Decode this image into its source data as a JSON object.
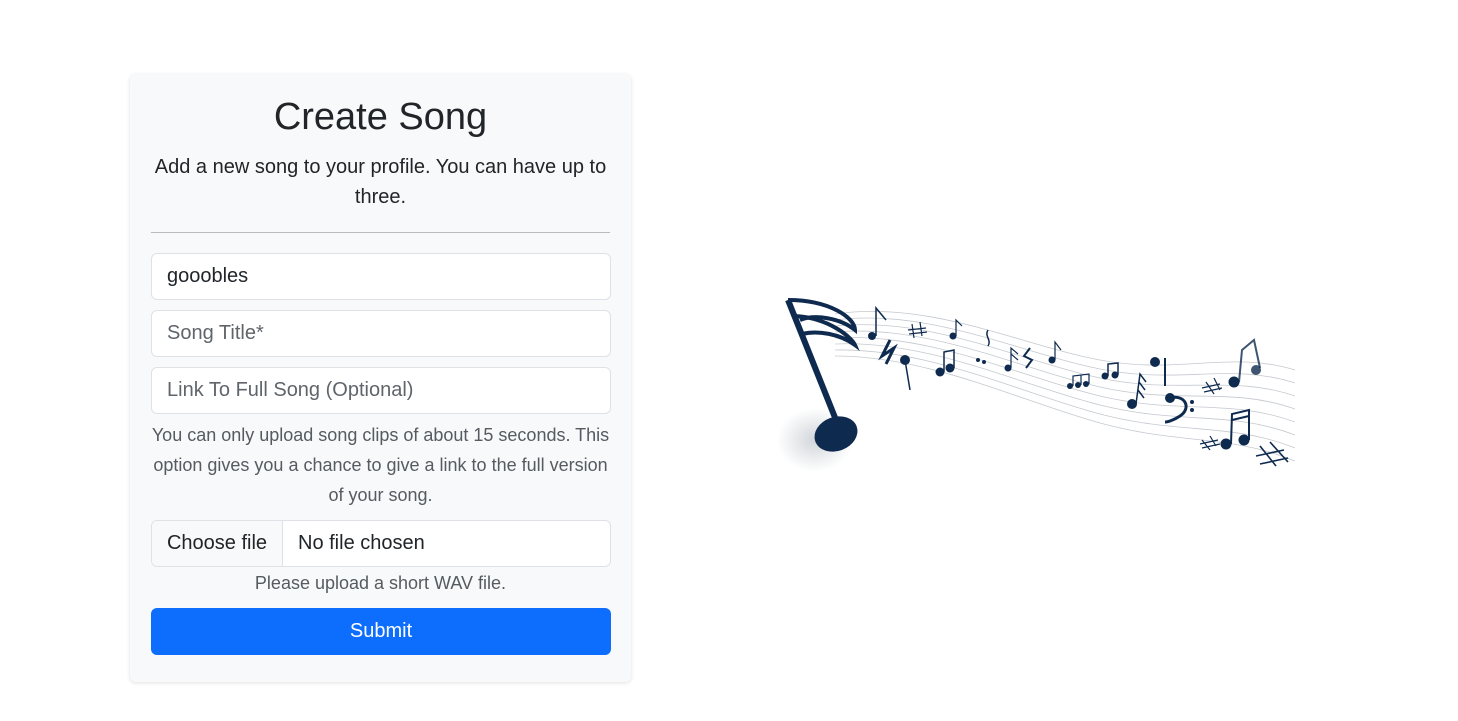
{
  "form": {
    "title": "Create Song",
    "subtitle": "Add a new song to your profile. You can have up to three.",
    "username_value": "gooobles",
    "song_title_placeholder": "Song Title*",
    "link_placeholder": "Link To Full Song (Optional)",
    "link_help": "You can only upload song clips of about 15 seconds. This option gives you a chance to give a link to the full version of your song.",
    "file_button_label": "Choose file",
    "file_status": "No file chosen",
    "file_help": "Please upload a short WAV file.",
    "submit_label": "Submit"
  },
  "colors": {
    "card_background": "#f8f9fa",
    "primary": "#0d6efd",
    "note_color": "#0f2a4f"
  },
  "decoration": {
    "icon": "music-notes-illustration"
  }
}
